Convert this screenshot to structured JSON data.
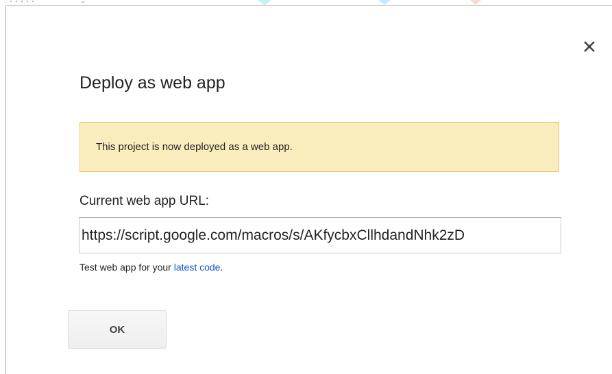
{
  "dialog": {
    "title": "Deploy as web app",
    "close_icon": "close-icon",
    "notice": "This project is now deployed as a web app.",
    "url_label": "Current web app URL:",
    "url_value": "https://script.google.com/macros/s/AKfycbxCllhdandNhk2zD",
    "test_prefix": "Test web app for your ",
    "test_link": "latest code",
    "test_suffix": ".",
    "ok_label": "OK"
  },
  "colors": {
    "notice_background": "#f9edbe",
    "notice_border": "#f0c36d",
    "link": "#1155cc"
  }
}
